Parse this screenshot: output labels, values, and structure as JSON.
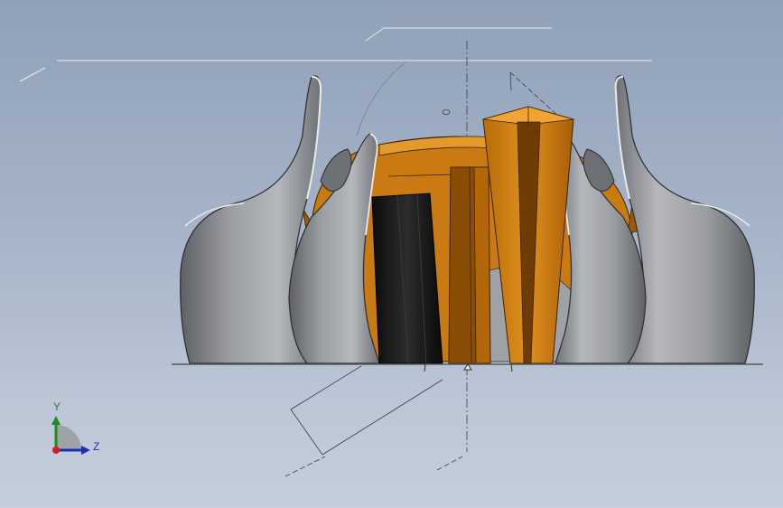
{
  "viewport": {
    "background_top": "#8fa0b8",
    "background_bottom": "#c5ceda"
  },
  "model": {
    "petal_color": "#8c8f93",
    "orange_color": "#d98a1a",
    "dark_orange_color": "#7a4306",
    "black_part_color": "#1a1a1a",
    "ground_line_color": "#555a60"
  },
  "triad": {
    "y_label": "Y",
    "z_label": "Z",
    "y_color": "#1f8a1f",
    "z_color": "#1f2fb0",
    "x_color": "#d02020",
    "icon": "coordinate-triad-icon"
  }
}
